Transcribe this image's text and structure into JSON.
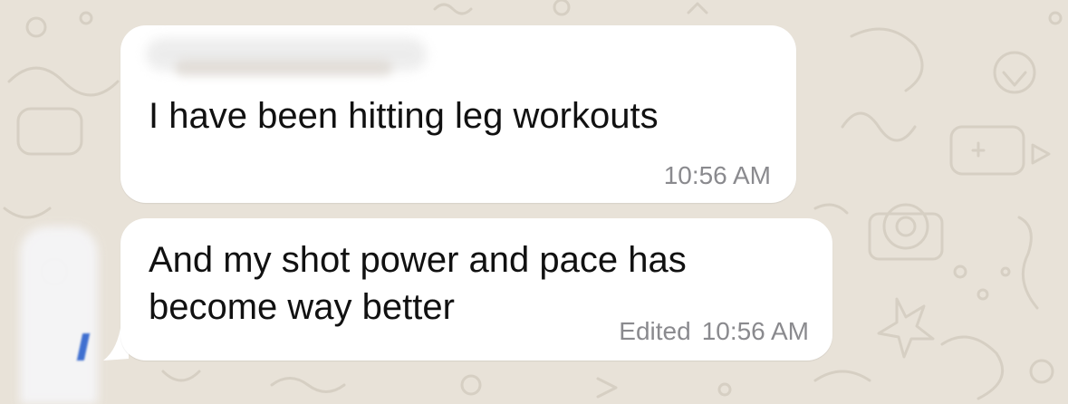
{
  "chat": {
    "messages": [
      {
        "text": "I have been hitting leg workouts",
        "time": "10:56 AM"
      },
      {
        "text": "And my shot power and pace has become way better",
        "edited_label": "Edited",
        "time": "10:56 AM"
      }
    ]
  },
  "colors": {
    "wallpaper": "#e8e2d8",
    "bubble": "#ffffff",
    "message_text": "#111111",
    "meta_text": "#8a8a8e"
  }
}
